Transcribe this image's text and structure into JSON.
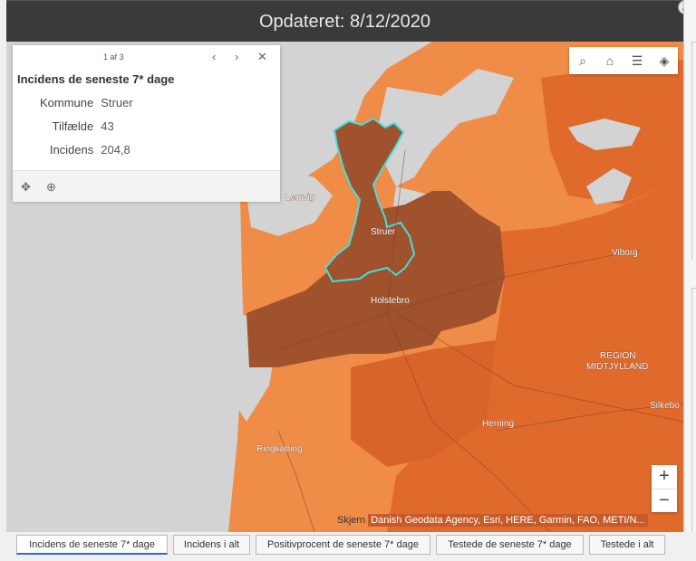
{
  "header": {
    "title": "Opdateret: 8/12/2020"
  },
  "popup": {
    "pager": "1 af 3",
    "title": "Incidens de seneste 7* dage",
    "fields": [
      {
        "label": "Kommune",
        "value": "Struer"
      },
      {
        "label": "Tilfælde",
        "value": "43"
      },
      {
        "label": "Incidens",
        "value": "204,8"
      }
    ],
    "prev_icon": "chevron-left-icon",
    "next_icon": "chevron-right-icon",
    "close_icon": "close-icon",
    "footer_icons": [
      "move-icon",
      "zoom-to-icon"
    ]
  },
  "toolbar": {
    "icons": [
      "search-icon",
      "home-icon",
      "legend-icon",
      "layers-icon"
    ]
  },
  "zoom": {
    "in": "+",
    "out": "−"
  },
  "map": {
    "labels": {
      "lemvig": "Lemvig",
      "struer": "Struer",
      "holstebro": "Holstebro",
      "viborg": "Viborg",
      "region1": "REGION",
      "region2": "MIDTJYLLAND",
      "silkeborg": "Silkebo",
      "herning": "Herning",
      "ringkobing": "Ringkøbing",
      "skjern": "Skjern"
    },
    "colors": {
      "water": "#d3d3d3",
      "light": "#ef8c47",
      "medium": "#e06a2c",
      "dark": "#c65a28",
      "selected": "#a0522d",
      "highlight": "#3ee0e0"
    }
  },
  "attribution": {
    "place": "Skjern",
    "text": "Danish Geodata Agency, Esri, HERE, Garmin, FAO, METI/N..."
  },
  "tabs": [
    "Incidens de seneste 7* dage",
    "Incidens i alt",
    "Positivprocent de seneste 7* dage",
    "Testede de seneste 7* dage",
    "Testede i alt"
  ]
}
